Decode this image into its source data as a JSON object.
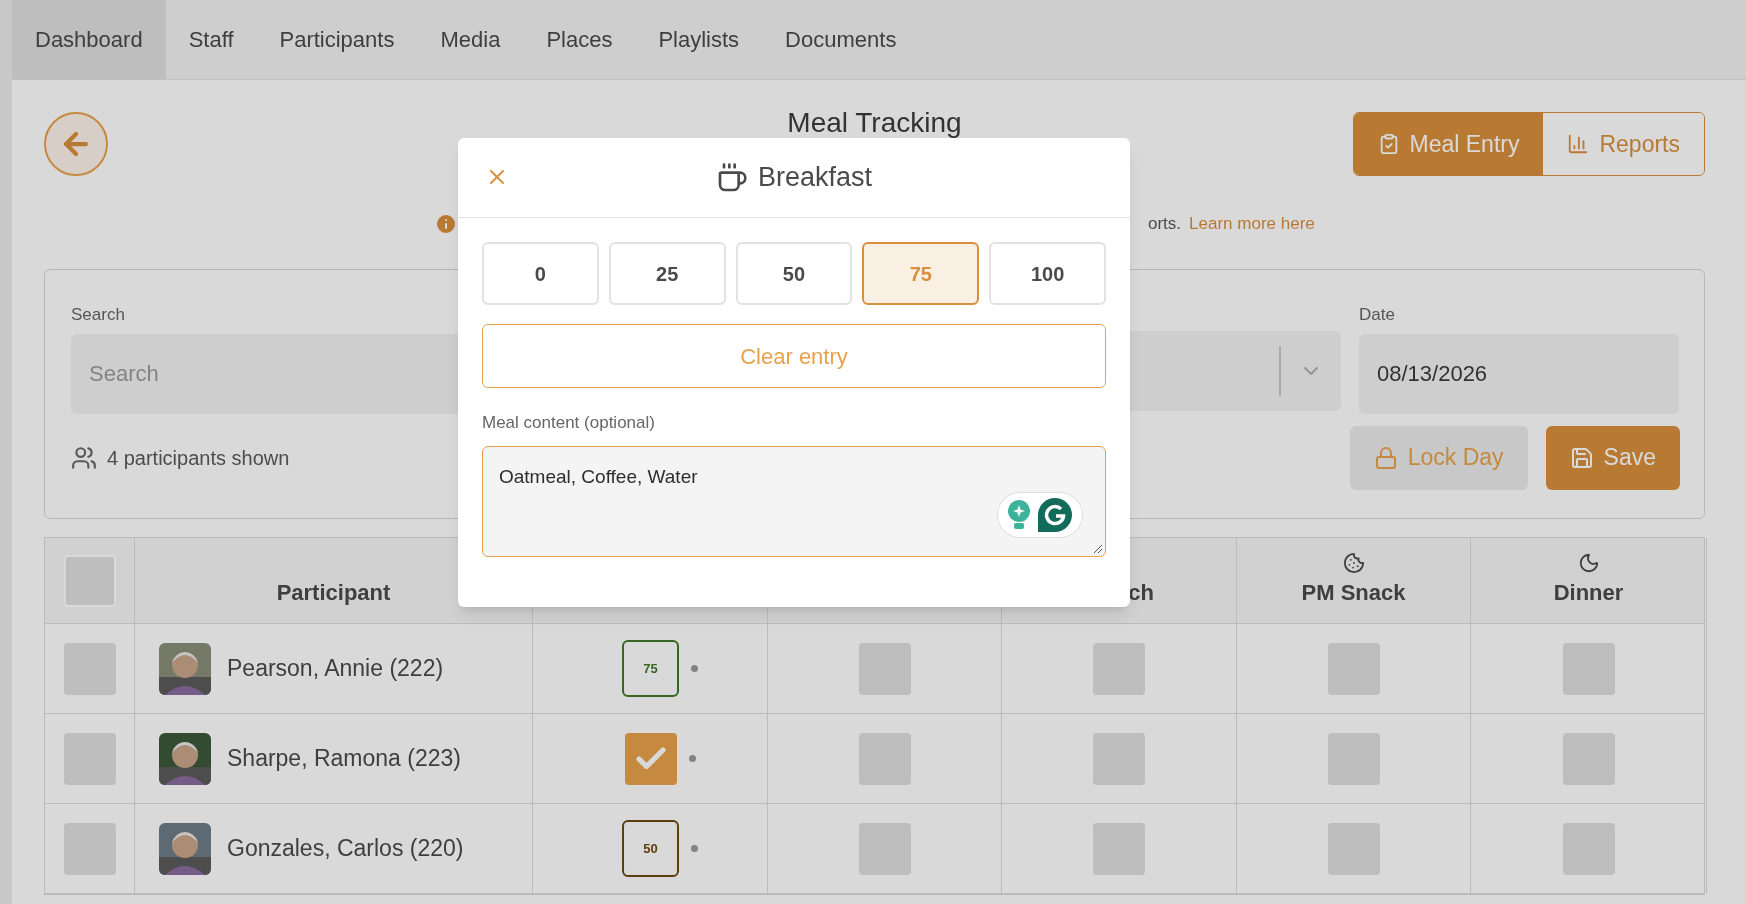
{
  "nav": {
    "tabs": [
      {
        "label": "Dashboard",
        "selected": true
      },
      {
        "label": "Staff",
        "selected": false
      },
      {
        "label": "Participants",
        "selected": false
      },
      {
        "label": "Media",
        "selected": false
      },
      {
        "label": "Places",
        "selected": false
      },
      {
        "label": "Playlists",
        "selected": false
      },
      {
        "label": "Documents",
        "selected": false
      }
    ]
  },
  "header": {
    "title": "Meal Tracking",
    "view_buttons": [
      {
        "label": "Meal Entry",
        "kind": "entry",
        "selected": true
      },
      {
        "label": "Reports",
        "kind": "reports",
        "selected": false
      }
    ]
  },
  "info": {
    "text": "orts.",
    "link": "Learn more here"
  },
  "filters": {
    "search": {
      "label": "Search",
      "placeholder": "Search"
    },
    "date": {
      "label": "Date",
      "value": "08/13/2026"
    },
    "count": "4 participants shown",
    "lock_button": {
      "label": "Lock Day",
      "disabled": true
    },
    "save_button": {
      "label": "Save"
    }
  },
  "table": {
    "select_all_checked": false,
    "columns": [
      {
        "label": "Participant",
        "kind": "text"
      },
      {
        "label": "ch",
        "kind": "partial"
      },
      {
        "label": "PM Snack",
        "kind": "snack"
      },
      {
        "label": "Dinner",
        "kind": "dinner"
      }
    ],
    "rows": [
      {
        "checked": false,
        "name": "Pearson, Annie (222)",
        "breakfast": {
          "kind": "value",
          "value": "75",
          "color": "#3f7a2a"
        },
        "other_meals": [
          {
            "checked": false
          },
          {
            "checked": false
          },
          {
            "checked": false
          },
          {
            "checked": false
          }
        ]
      },
      {
        "checked": false,
        "name": "Sharpe, Ramona (223)",
        "breakfast": {
          "kind": "check"
        },
        "other_meals": [
          {
            "checked": false
          },
          {
            "checked": false
          },
          {
            "checked": false
          },
          {
            "checked": false
          }
        ]
      },
      {
        "checked": false,
        "name": "Gonzales, Carlos (220)",
        "breakfast": {
          "kind": "value",
          "value": "50",
          "color": "#6b4a12"
        },
        "other_meals": [
          {
            "checked": false
          },
          {
            "checked": false
          },
          {
            "checked": false
          },
          {
            "checked": false
          }
        ]
      }
    ]
  },
  "modal": {
    "title": "Breakfast",
    "options": [
      {
        "label": "0",
        "selected": false
      },
      {
        "label": "25",
        "selected": false
      },
      {
        "label": "50",
        "selected": false
      },
      {
        "label": "75",
        "selected": true
      },
      {
        "label": "100",
        "selected": false
      }
    ],
    "clear_button": "Clear entry",
    "content_label": "Meal content (optional)",
    "content_value": "Oatmeal, Coffee, Water"
  }
}
